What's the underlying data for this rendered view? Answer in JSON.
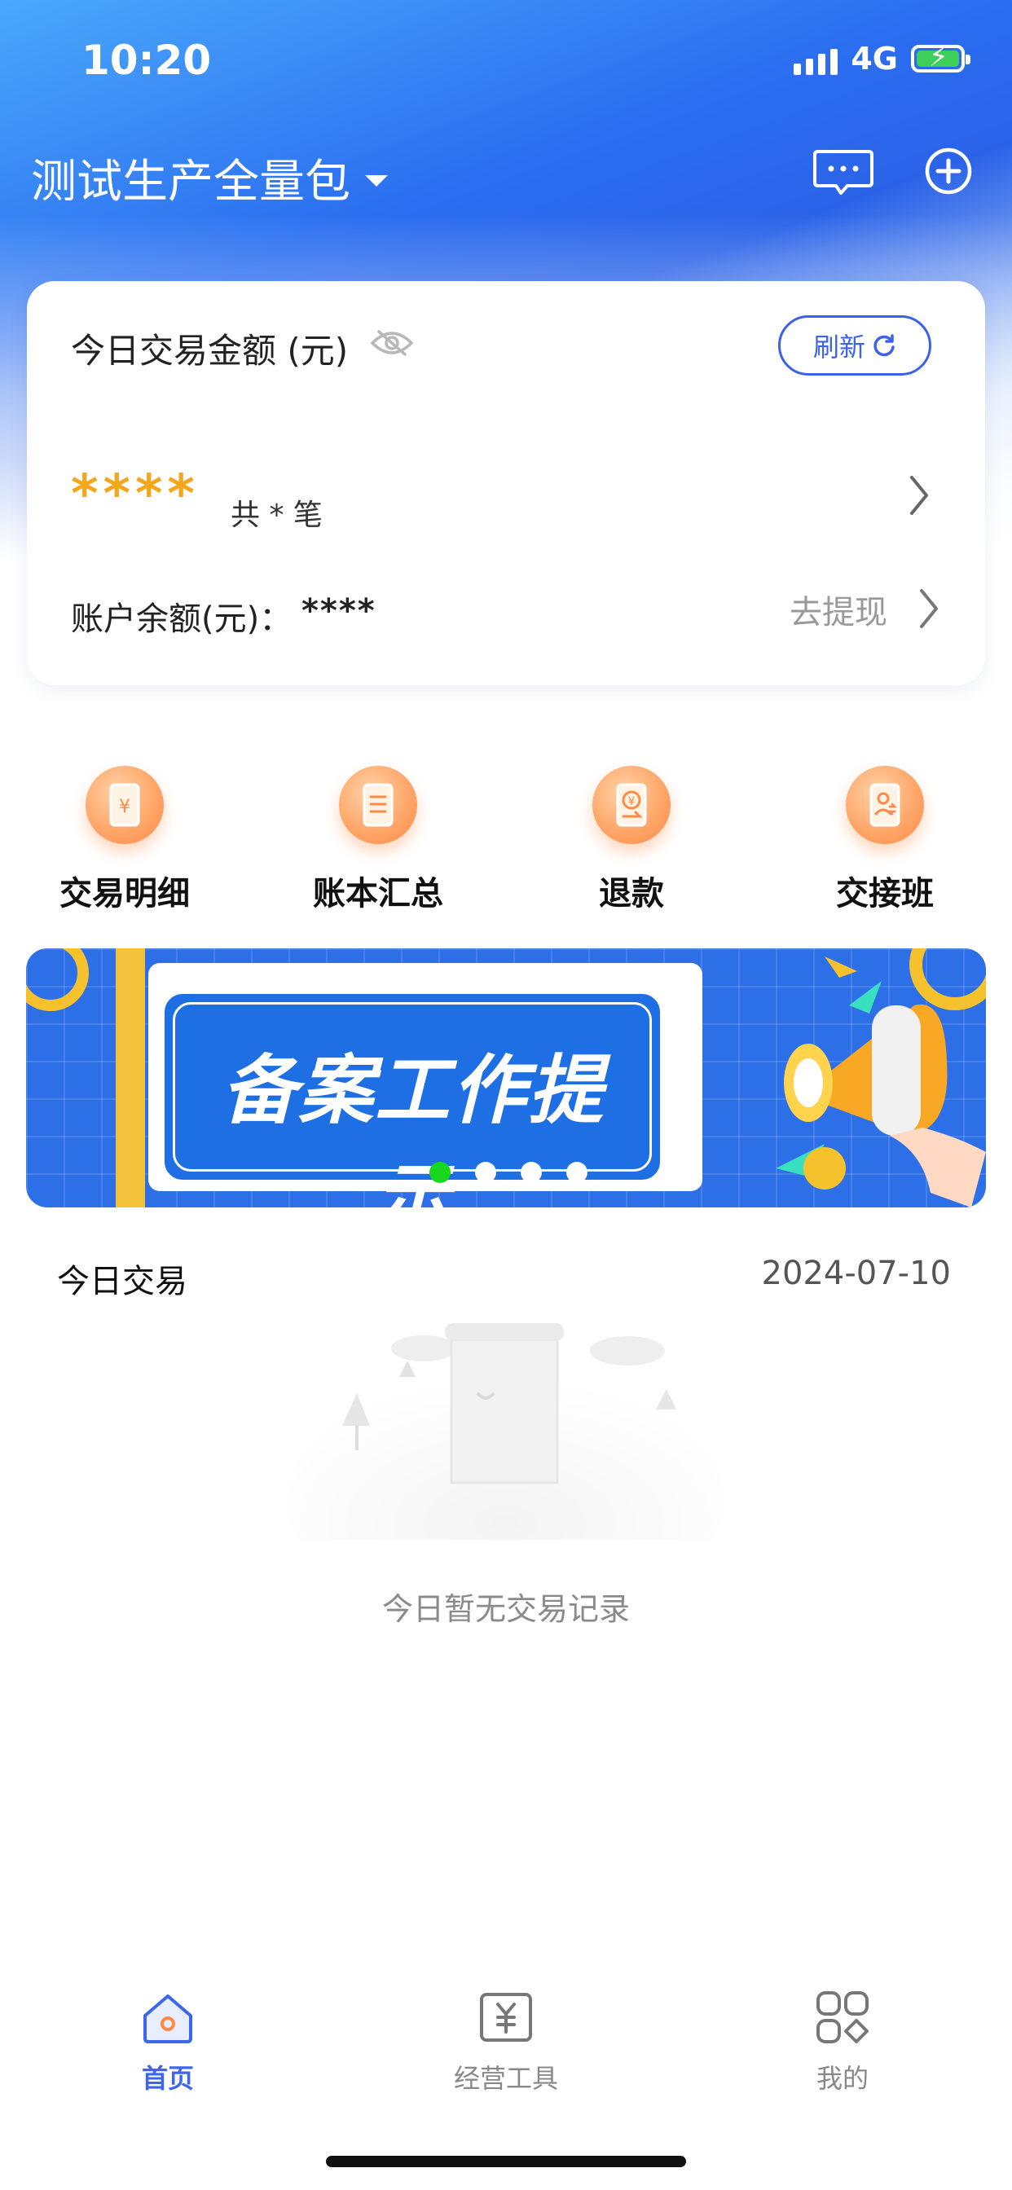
{
  "status_bar": {
    "time": "10:20",
    "network": "4G"
  },
  "header": {
    "store_name": "测试生产全量包"
  },
  "summary_card": {
    "title": "今日交易金额 (元)",
    "refresh_label": "刷新",
    "amount": "****",
    "count": "共 * 笔",
    "balance_label": "账户余额(元)：",
    "balance_value": "****",
    "withdraw_label": "去提现"
  },
  "quick_actions": [
    {
      "label": "交易明细",
      "icon": "transaction-detail-icon"
    },
    {
      "label": "账本汇总",
      "icon": "ledger-summary-icon"
    },
    {
      "label": "退款",
      "icon": "refund-icon"
    },
    {
      "label": "交接班",
      "icon": "shift-handover-icon"
    }
  ],
  "banner": {
    "title": "备案工作提示",
    "slide_count": 4,
    "active_slide": 1
  },
  "today": {
    "label": "今日交易",
    "date": "2024-07-10",
    "empty_text": "今日暂无交易记录"
  },
  "tab_bar": [
    {
      "label": "首页",
      "icon": "home-icon",
      "active": true
    },
    {
      "label": "经营工具",
      "icon": "business-tools-icon",
      "active": false
    },
    {
      "label": "我的",
      "icon": "profile-grid-icon",
      "active": false
    }
  ],
  "colors": {
    "accent": "#3b62e8",
    "amount": "#f3a71c",
    "action_orange": "#ff8a47",
    "banner_blue": "#2d6fe6",
    "active_dot": "#19d61f"
  }
}
